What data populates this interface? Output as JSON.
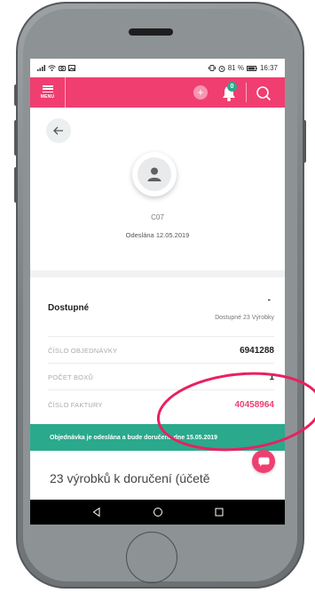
{
  "statusbar": {
    "left_icons": "signal wifi camera gallery",
    "right_text": "81 %",
    "time": "16:37"
  },
  "topbar": {
    "menu_label": "MENU",
    "plus_symbol": "+",
    "notification_count": "0",
    "accent_color": "#f03e70"
  },
  "order": {
    "code": "C07",
    "sent_label": "Odeslána 12.05.2019",
    "dash": "-",
    "availability_title": "Dostupné",
    "availability_sub": "Dostupné 23 Výrobky",
    "rows": [
      {
        "label": "ČÍSLO OBJEDNÁVKY",
        "value": "6941288",
        "highlight": false
      },
      {
        "label": "POČET BOXŮ",
        "value": "1",
        "highlight": false
      },
      {
        "label": "ČÍSLO FAKTURY",
        "value": "40458964",
        "highlight": true
      }
    ],
    "banner": "Objednávka je odeslána a bude doručena dne 15.05.2019",
    "banner_color": "#2aa98d",
    "bottom_text": "23 výrobků k doručení (účetě"
  },
  "icons": {
    "back": "back-arrow-icon",
    "avatar": "user-icon",
    "chat": "chat-icon",
    "bell": "bell-icon",
    "search": "search-icon"
  }
}
